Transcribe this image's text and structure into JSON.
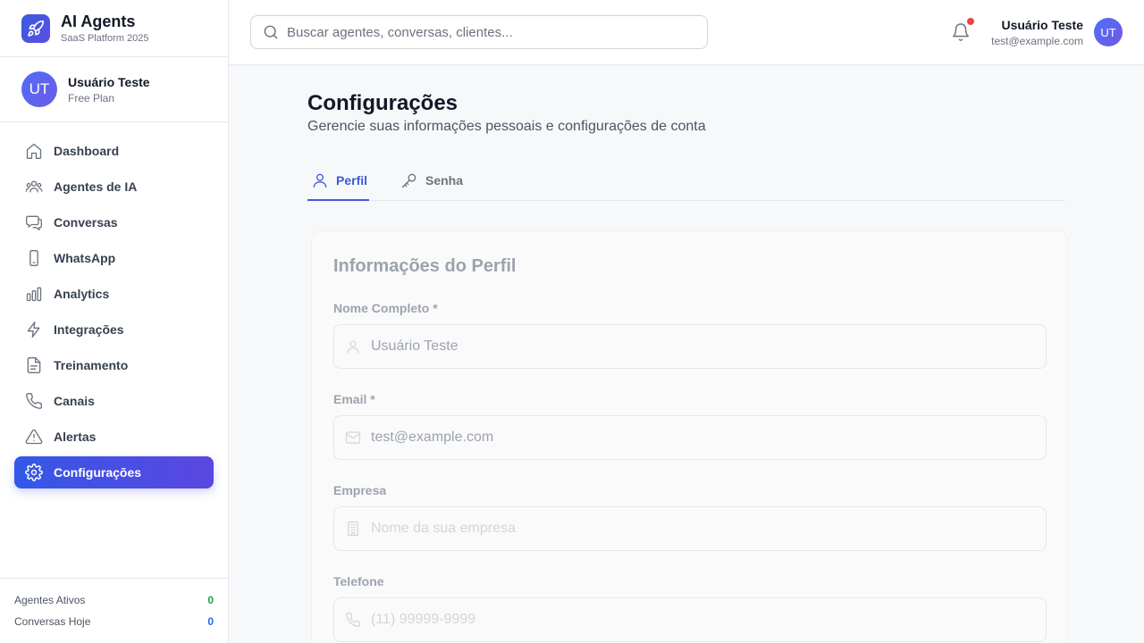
{
  "brand": {
    "title": "AI Agents",
    "subtitle": "SaaS Platform 2025",
    "logo_icon": "rocket-icon"
  },
  "sidebar_user": {
    "initials": "UT",
    "name": "Usuário Teste",
    "plan": "Free Plan"
  },
  "nav": {
    "items": [
      {
        "label": "Dashboard",
        "icon": "home-icon",
        "active": false
      },
      {
        "label": "Agentes de IA",
        "icon": "users-icon",
        "active": false
      },
      {
        "label": "Conversas",
        "icon": "chat-icon",
        "active": false
      },
      {
        "label": "WhatsApp",
        "icon": "phone-device-icon",
        "active": false
      },
      {
        "label": "Analytics",
        "icon": "bar-chart-icon",
        "active": false
      },
      {
        "label": "Integrações",
        "icon": "lightning-icon",
        "active": false
      },
      {
        "label": "Treinamento",
        "icon": "document-icon",
        "active": false
      },
      {
        "label": "Canais",
        "icon": "phone-icon",
        "active": false
      },
      {
        "label": "Alertas",
        "icon": "warning-icon",
        "active": false
      },
      {
        "label": "Configurações",
        "icon": "gear-icon",
        "active": true
      }
    ]
  },
  "stats": {
    "active_agents_label": "Agentes Ativos",
    "active_agents_value": "0",
    "conversations_today_label": "Conversas Hoje",
    "conversations_today_value": "0"
  },
  "header": {
    "search_placeholder": "Buscar agentes, conversas, clientes...",
    "user_name": "Usuário Teste",
    "user_email": "test@example.com",
    "user_initials": "UT"
  },
  "page": {
    "title": "Configurações",
    "subtitle": "Gerencie suas informações pessoais e configurações de conta",
    "tabs": [
      {
        "label": "Perfil",
        "icon": "user-icon",
        "active": true
      },
      {
        "label": "Senha",
        "icon": "key-icon",
        "active": false
      }
    ]
  },
  "profile": {
    "title": "Informações do Perfil",
    "fields": [
      {
        "label": "Nome Completo *",
        "value": "Usuário Teste",
        "placeholder": "",
        "icon": "user-icon"
      },
      {
        "label": "Email *",
        "value": "test@example.com",
        "placeholder": "",
        "icon": "mail-icon"
      },
      {
        "label": "Empresa",
        "value": "",
        "placeholder": "Nome da sua empresa",
        "icon": "building-icon"
      },
      {
        "label": "Telefone",
        "value": "",
        "placeholder": "(11) 99999-9999",
        "icon": "phone-icon"
      }
    ]
  },
  "colors": {
    "accent": "#3b5bdb",
    "accent_gradient_end": "#5b46e0",
    "notification_dot": "#ef4444",
    "stat_green": "#16a34a",
    "stat_blue": "#2563eb"
  }
}
